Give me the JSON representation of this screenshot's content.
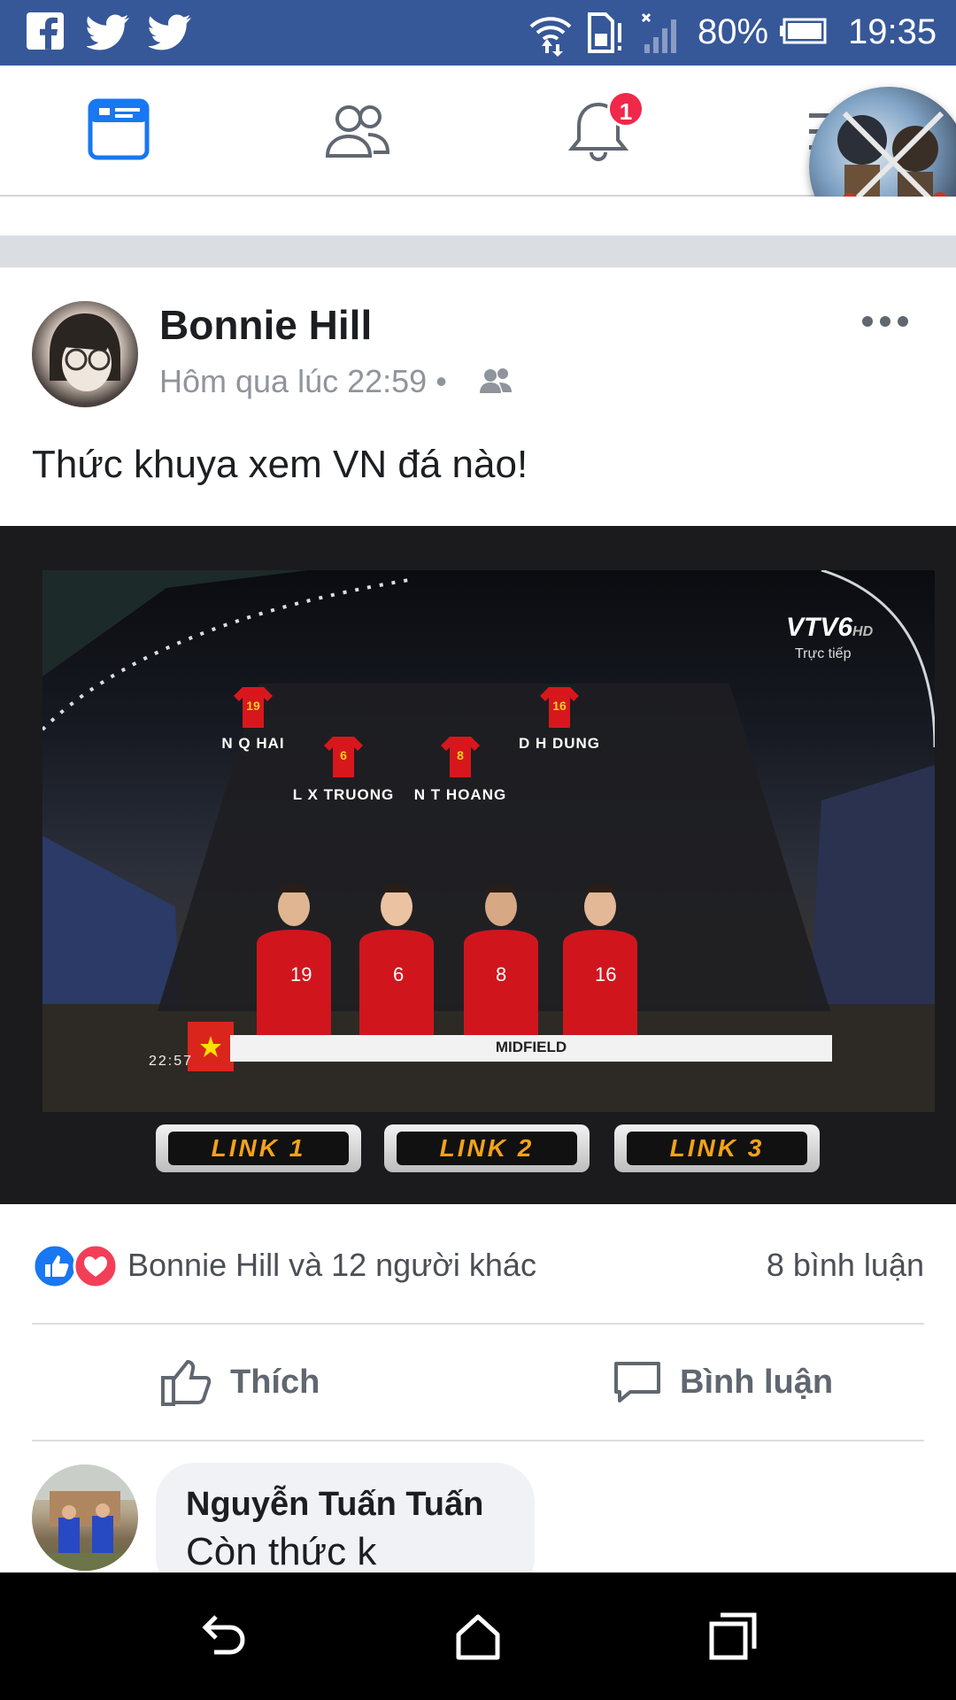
{
  "status_bar": {
    "notification_icons": [
      "facebook-icon",
      "twitter-icon",
      "twitter-icon"
    ],
    "battery_percent": "80%",
    "time": "19:35"
  },
  "nav": {
    "items": [
      "news-feed-icon",
      "friends-icon",
      "notifications-icon",
      "menu-icon"
    ],
    "notification_badge": "1"
  },
  "post": {
    "author": "Bonnie Hill",
    "time": "Hôm qua lúc 22:59 •",
    "text": "Thức khuya xem VN đá nào!",
    "image": {
      "channel_logo": "VTV6",
      "channel_hd": "HD",
      "channel_live": "Trực tiếp",
      "players": [
        {
          "number": "19",
          "name": "N Q HAI"
        },
        {
          "number": "6",
          "name": "L X TRUONG"
        },
        {
          "number": "8",
          "name": "N T HOANG"
        },
        {
          "number": "16",
          "name": "D H DUNG"
        }
      ],
      "position_label": "MIDFIELD",
      "broadcast_time": "22:57",
      "links": [
        "LINK 1",
        "LINK 2",
        "LINK 3"
      ]
    },
    "reactions": {
      "summary": "Bonnie Hill và 12 người khác",
      "comment_count": "8 bình luận"
    },
    "actions": {
      "like_label": "Thích",
      "comment_label": "Bình luận"
    }
  },
  "comment": {
    "author": "Nguyễn Tuấn Tuấn",
    "text": "Còn thức k"
  },
  "colors": {
    "facebook_blue": "#365899",
    "brand_blue": "#1877f2",
    "like_blue": "#1877f2",
    "love_red": "#f33e58",
    "badge_red": "#f02849"
  }
}
